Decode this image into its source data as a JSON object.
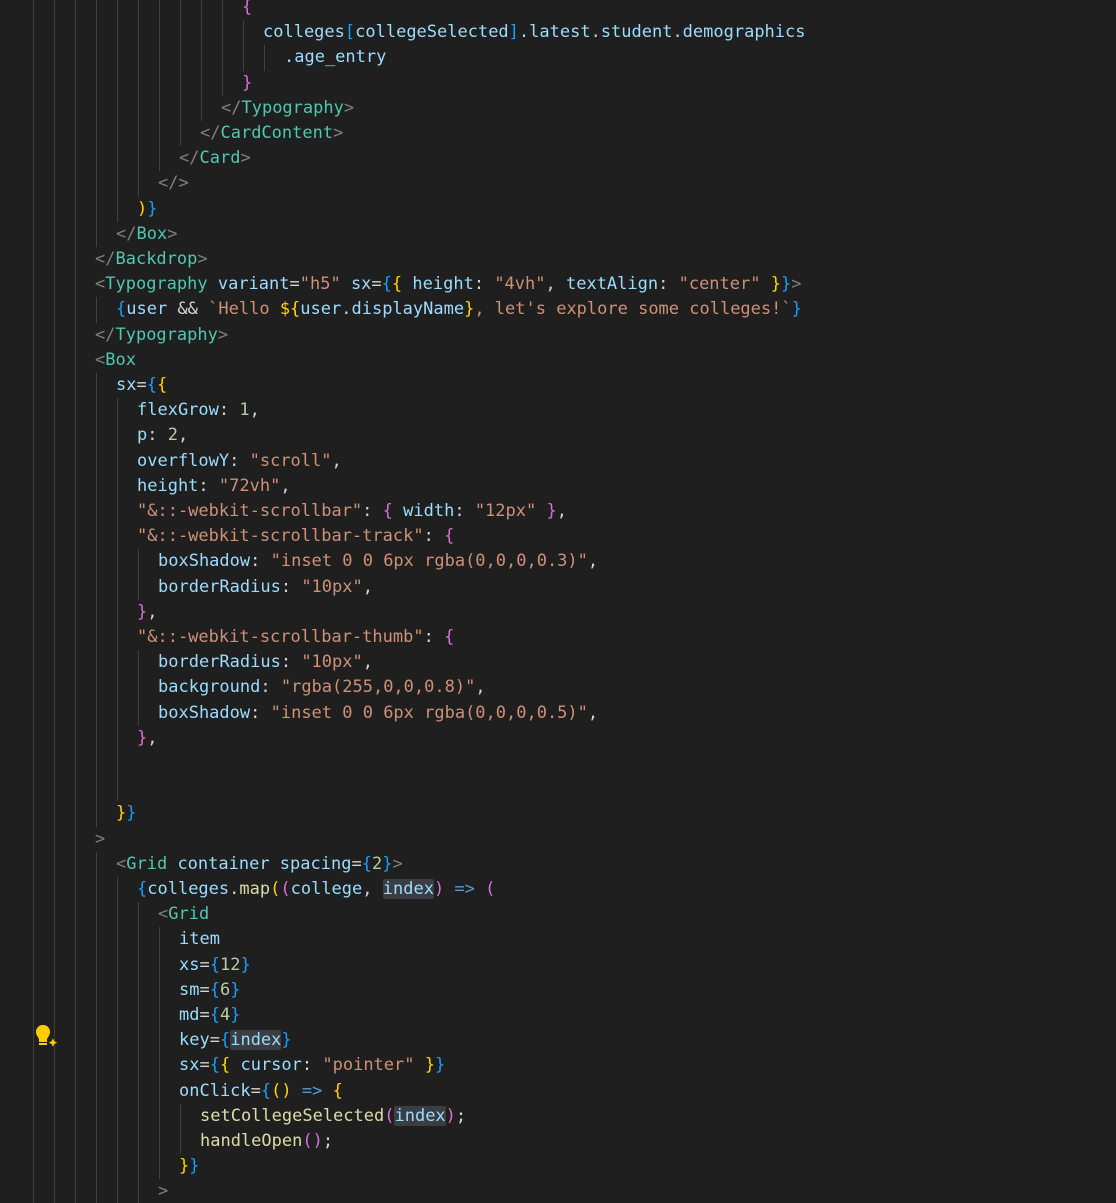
{
  "editor": {
    "lines": [
      {
        "indent": 242,
        "tokens": [
          {
            "t": "{",
            "c": "b2"
          }
        ]
      },
      {
        "indent": 263,
        "tokens": [
          {
            "t": "colleges",
            "c": "attr"
          },
          {
            "t": "[",
            "c": "b3"
          },
          {
            "t": "collegeSelected",
            "c": "attr"
          },
          {
            "t": "]",
            "c": "b3"
          },
          {
            "t": ".latest.student.demographics",
            "c": "attr"
          }
        ]
      },
      {
        "indent": 284,
        "tokens": [
          {
            "t": ".age_entry",
            "c": "attr"
          }
        ]
      },
      {
        "indent": 242,
        "tokens": [
          {
            "t": "}",
            "c": "b2"
          }
        ]
      },
      {
        "indent": 221,
        "tokens": [
          {
            "t": "</",
            "c": "punc"
          },
          {
            "t": "Typography",
            "c": "tag"
          },
          {
            "t": ">",
            "c": "punc"
          }
        ]
      },
      {
        "indent": 200,
        "tokens": [
          {
            "t": "</",
            "c": "punc"
          },
          {
            "t": "CardContent",
            "c": "tag"
          },
          {
            "t": ">",
            "c": "punc"
          }
        ]
      },
      {
        "indent": 179,
        "tokens": [
          {
            "t": "</",
            "c": "punc"
          },
          {
            "t": "Card",
            "c": "tag"
          },
          {
            "t": ">",
            "c": "punc"
          }
        ]
      },
      {
        "indent": 158,
        "tokens": [
          {
            "t": "</>",
            "c": "punc"
          }
        ]
      },
      {
        "indent": 137,
        "tokens": [
          {
            "t": ")",
            "c": "b1"
          },
          {
            "t": "}",
            "c": "b3"
          }
        ]
      },
      {
        "indent": 116,
        "tokens": [
          {
            "t": "</",
            "c": "punc"
          },
          {
            "t": "Box",
            "c": "tag"
          },
          {
            "t": ">",
            "c": "punc"
          }
        ]
      },
      {
        "indent": 95,
        "tokens": [
          {
            "t": "</",
            "c": "punc"
          },
          {
            "t": "Backdrop",
            "c": "tag"
          },
          {
            "t": ">",
            "c": "punc"
          }
        ]
      },
      {
        "indent": 95,
        "tokens": [
          {
            "t": "<",
            "c": "punc"
          },
          {
            "t": "Typography",
            "c": "tag"
          },
          {
            "t": " variant",
            "c": "attr"
          },
          {
            "t": "=",
            "c": "txt"
          },
          {
            "t": "\"h5\"",
            "c": "str"
          },
          {
            "t": " sx",
            "c": "attr"
          },
          {
            "t": "=",
            "c": "txt"
          },
          {
            "t": "{",
            "c": "b3"
          },
          {
            "t": "{",
            "c": "b1"
          },
          {
            "t": " height",
            "c": "attr"
          },
          {
            "t": ": ",
            "c": "txt"
          },
          {
            "t": "\"4vh\"",
            "c": "str"
          },
          {
            "t": ", ",
            "c": "txt"
          },
          {
            "t": "textAlign",
            "c": "attr"
          },
          {
            "t": ": ",
            "c": "txt"
          },
          {
            "t": "\"center\"",
            "c": "str"
          },
          {
            "t": " ",
            "c": "txt"
          },
          {
            "t": "}",
            "c": "b1"
          },
          {
            "t": "}",
            "c": "b3"
          },
          {
            "t": ">",
            "c": "punc"
          }
        ]
      },
      {
        "indent": 116,
        "tokens": [
          {
            "t": "{",
            "c": "b3"
          },
          {
            "t": "user",
            "c": "attr"
          },
          {
            "t": " && ",
            "c": "txt"
          },
          {
            "t": "`Hello ",
            "c": "str"
          },
          {
            "t": "${",
            "c": "b1"
          },
          {
            "t": "user",
            "c": "attr"
          },
          {
            "t": ".displayName",
            "c": "attr"
          },
          {
            "t": "}",
            "c": "b1"
          },
          {
            "t": ", let's explore some colleges!`",
            "c": "str"
          },
          {
            "t": "}",
            "c": "b3"
          }
        ]
      },
      {
        "indent": 95,
        "tokens": [
          {
            "t": "</",
            "c": "punc"
          },
          {
            "t": "Typography",
            "c": "tag"
          },
          {
            "t": ">",
            "c": "punc"
          }
        ]
      },
      {
        "indent": 95,
        "tokens": [
          {
            "t": "<",
            "c": "punc"
          },
          {
            "t": "Box",
            "c": "tag"
          }
        ]
      },
      {
        "indent": 116,
        "tokens": [
          {
            "t": "sx",
            "c": "attr"
          },
          {
            "t": "=",
            "c": "txt"
          },
          {
            "t": "{",
            "c": "b3"
          },
          {
            "t": "{",
            "c": "b1"
          }
        ]
      },
      {
        "indent": 137,
        "tokens": [
          {
            "t": "flexGrow",
            "c": "attr"
          },
          {
            "t": ": ",
            "c": "txt"
          },
          {
            "t": "1",
            "c": "num"
          },
          {
            "t": ",",
            "c": "txt"
          }
        ]
      },
      {
        "indent": 137,
        "tokens": [
          {
            "t": "p",
            "c": "attr"
          },
          {
            "t": ": ",
            "c": "txt"
          },
          {
            "t": "2",
            "c": "num"
          },
          {
            "t": ",",
            "c": "txt"
          }
        ]
      },
      {
        "indent": 137,
        "tokens": [
          {
            "t": "overflowY",
            "c": "attr"
          },
          {
            "t": ": ",
            "c": "txt"
          },
          {
            "t": "\"scroll\"",
            "c": "str"
          },
          {
            "t": ",",
            "c": "txt"
          }
        ]
      },
      {
        "indent": 137,
        "tokens": [
          {
            "t": "height",
            "c": "attr"
          },
          {
            "t": ": ",
            "c": "txt"
          },
          {
            "t": "\"72vh\"",
            "c": "str"
          },
          {
            "t": ",",
            "c": "txt"
          }
        ]
      },
      {
        "indent": 137,
        "tokens": [
          {
            "t": "\"&::-webkit-scrollbar\"",
            "c": "str"
          },
          {
            "t": ": ",
            "c": "txt"
          },
          {
            "t": "{",
            "c": "b2"
          },
          {
            "t": " width",
            "c": "attr"
          },
          {
            "t": ": ",
            "c": "txt"
          },
          {
            "t": "\"12px\"",
            "c": "str"
          },
          {
            "t": " ",
            "c": "txt"
          },
          {
            "t": "}",
            "c": "b2"
          },
          {
            "t": ",",
            "c": "txt"
          }
        ]
      },
      {
        "indent": 137,
        "tokens": [
          {
            "t": "\"&::-webkit-scrollbar-track\"",
            "c": "str"
          },
          {
            "t": ": ",
            "c": "txt"
          },
          {
            "t": "{",
            "c": "b2"
          }
        ]
      },
      {
        "indent": 158,
        "tokens": [
          {
            "t": "boxShadow",
            "c": "attr"
          },
          {
            "t": ": ",
            "c": "txt"
          },
          {
            "t": "\"inset 0 0 6px rgba(0,0,0,0.3)\"",
            "c": "str"
          },
          {
            "t": ",",
            "c": "txt"
          }
        ]
      },
      {
        "indent": 158,
        "tokens": [
          {
            "t": "borderRadius",
            "c": "attr"
          },
          {
            "t": ": ",
            "c": "txt"
          },
          {
            "t": "\"10px\"",
            "c": "str"
          },
          {
            "t": ",",
            "c": "txt"
          }
        ]
      },
      {
        "indent": 137,
        "tokens": [
          {
            "t": "}",
            "c": "b2"
          },
          {
            "t": ",",
            "c": "txt"
          }
        ]
      },
      {
        "indent": 137,
        "tokens": [
          {
            "t": "\"&::-webkit-scrollbar-thumb\"",
            "c": "str"
          },
          {
            "t": ": ",
            "c": "txt"
          },
          {
            "t": "{",
            "c": "b2"
          }
        ]
      },
      {
        "indent": 158,
        "tokens": [
          {
            "t": "borderRadius",
            "c": "attr"
          },
          {
            "t": ": ",
            "c": "txt"
          },
          {
            "t": "\"10px\"",
            "c": "str"
          },
          {
            "t": ",",
            "c": "txt"
          }
        ]
      },
      {
        "indent": 158,
        "tokens": [
          {
            "t": "background",
            "c": "attr"
          },
          {
            "t": ": ",
            "c": "txt"
          },
          {
            "t": "\"rgba(255,0,0,0.8)\"",
            "c": "str"
          },
          {
            "t": ",",
            "c": "txt"
          }
        ]
      },
      {
        "indent": 158,
        "tokens": [
          {
            "t": "boxShadow",
            "c": "attr"
          },
          {
            "t": ": ",
            "c": "txt"
          },
          {
            "t": "\"inset 0 0 6px rgba(0,0,0,0.5)\"",
            "c": "str"
          },
          {
            "t": ",",
            "c": "txt"
          }
        ]
      },
      {
        "indent": 137,
        "tokens": [
          {
            "t": "}",
            "c": "b2"
          },
          {
            "t": ",",
            "c": "txt"
          }
        ]
      },
      {
        "indent": 137,
        "tokens": []
      },
      {
        "indent": 137,
        "tokens": []
      },
      {
        "indent": 116,
        "tokens": [
          {
            "t": "}",
            "c": "b1"
          },
          {
            "t": "}",
            "c": "b3"
          }
        ]
      },
      {
        "indent": 95,
        "tokens": [
          {
            "t": ">",
            "c": "punc"
          }
        ]
      },
      {
        "indent": 116,
        "tokens": [
          {
            "t": "<",
            "c": "punc"
          },
          {
            "t": "Grid",
            "c": "tag"
          },
          {
            "t": " container",
            "c": "attr"
          },
          {
            "t": " spacing",
            "c": "attr"
          },
          {
            "t": "=",
            "c": "txt"
          },
          {
            "t": "{",
            "c": "b3"
          },
          {
            "t": "2",
            "c": "num"
          },
          {
            "t": "}",
            "c": "b3"
          },
          {
            "t": ">",
            "c": "punc"
          }
        ]
      },
      {
        "indent": 137,
        "tokens": [
          {
            "t": "{",
            "c": "b3"
          },
          {
            "t": "colleges",
            "c": "attr"
          },
          {
            "t": ".",
            "c": "txt"
          },
          {
            "t": "map",
            "c": "fn"
          },
          {
            "t": "(",
            "c": "b1"
          },
          {
            "t": "(",
            "c": "b2"
          },
          {
            "t": "college",
            "c": "attr"
          },
          {
            "t": ", ",
            "c": "txt"
          },
          {
            "t": "index",
            "c": "attr",
            "hl": true
          },
          {
            "t": ")",
            "c": "b2"
          },
          {
            "t": " => ",
            "c": "kw"
          },
          {
            "t": "(",
            "c": "b2"
          }
        ]
      },
      {
        "indent": 158,
        "tokens": [
          {
            "t": "<",
            "c": "punc"
          },
          {
            "t": "Grid",
            "c": "tag"
          }
        ]
      },
      {
        "indent": 179,
        "tokens": [
          {
            "t": "item",
            "c": "attr"
          }
        ]
      },
      {
        "indent": 179,
        "tokens": [
          {
            "t": "xs",
            "c": "attr"
          },
          {
            "t": "=",
            "c": "txt"
          },
          {
            "t": "{",
            "c": "b3"
          },
          {
            "t": "12",
            "c": "num"
          },
          {
            "t": "}",
            "c": "b3"
          }
        ]
      },
      {
        "indent": 179,
        "tokens": [
          {
            "t": "sm",
            "c": "attr"
          },
          {
            "t": "=",
            "c": "txt"
          },
          {
            "t": "{",
            "c": "b3"
          },
          {
            "t": "6",
            "c": "num"
          },
          {
            "t": "}",
            "c": "b3"
          }
        ]
      },
      {
        "indent": 179,
        "tokens": [
          {
            "t": "md",
            "c": "attr"
          },
          {
            "t": "=",
            "c": "txt"
          },
          {
            "t": "{",
            "c": "b3"
          },
          {
            "t": "4",
            "c": "num"
          },
          {
            "t": "}",
            "c": "b3"
          }
        ]
      },
      {
        "indent": 179,
        "tokens": [
          {
            "t": "key",
            "c": "attr"
          },
          {
            "t": "=",
            "c": "txt"
          },
          {
            "t": "{",
            "c": "b3"
          },
          {
            "t": "index",
            "c": "attr",
            "hl": true
          },
          {
            "t": "}",
            "c": "b3"
          }
        ]
      },
      {
        "indent": 179,
        "tokens": [
          {
            "t": "sx",
            "c": "attr"
          },
          {
            "t": "=",
            "c": "txt"
          },
          {
            "t": "{",
            "c": "b3"
          },
          {
            "t": "{",
            "c": "b1"
          },
          {
            "t": " cursor",
            "c": "attr"
          },
          {
            "t": ": ",
            "c": "txt"
          },
          {
            "t": "\"pointer\"",
            "c": "str"
          },
          {
            "t": " ",
            "c": "txt"
          },
          {
            "t": "}",
            "c": "b1"
          },
          {
            "t": "}",
            "c": "b3"
          }
        ]
      },
      {
        "indent": 179,
        "tokens": [
          {
            "t": "onClick",
            "c": "attr"
          },
          {
            "t": "=",
            "c": "txt"
          },
          {
            "t": "{",
            "c": "b3"
          },
          {
            "t": "(",
            "c": "b1"
          },
          {
            "t": ")",
            "c": "b1"
          },
          {
            "t": " => ",
            "c": "kw"
          },
          {
            "t": "{",
            "c": "b1"
          }
        ]
      },
      {
        "indent": 200,
        "tokens": [
          {
            "t": "setCollegeSelected",
            "c": "fn"
          },
          {
            "t": "(",
            "c": "b2"
          },
          {
            "t": "index",
            "c": "attr",
            "hl": true
          },
          {
            "t": ")",
            "c": "b2"
          },
          {
            "t": ";",
            "c": "txt"
          }
        ]
      },
      {
        "indent": 200,
        "tokens": [
          {
            "t": "handleOpen",
            "c": "fn"
          },
          {
            "t": "(",
            "c": "b2"
          },
          {
            "t": ")",
            "c": "b2"
          },
          {
            "t": ";",
            "c": "txt"
          }
        ]
      },
      {
        "indent": 179,
        "tokens": [
          {
            "t": "}",
            "c": "b1"
          },
          {
            "t": "}",
            "c": "b3"
          }
        ]
      },
      {
        "indent": 158,
        "tokens": [
          {
            "t": ">",
            "c": "punc"
          }
        ]
      }
    ]
  },
  "colors": {
    "background": "#1f1f1f",
    "tag": "#4ec9b0",
    "attribute": "#9cdcfe",
    "string": "#ce9178",
    "number": "#b5cea8",
    "function": "#dcdcaa",
    "bracket_gold": "#ffd700",
    "bracket_orchid": "#da70d6",
    "bracket_blue": "#179fff"
  },
  "icons": {
    "lightbulb": "lightbulb-autofix-icon"
  }
}
